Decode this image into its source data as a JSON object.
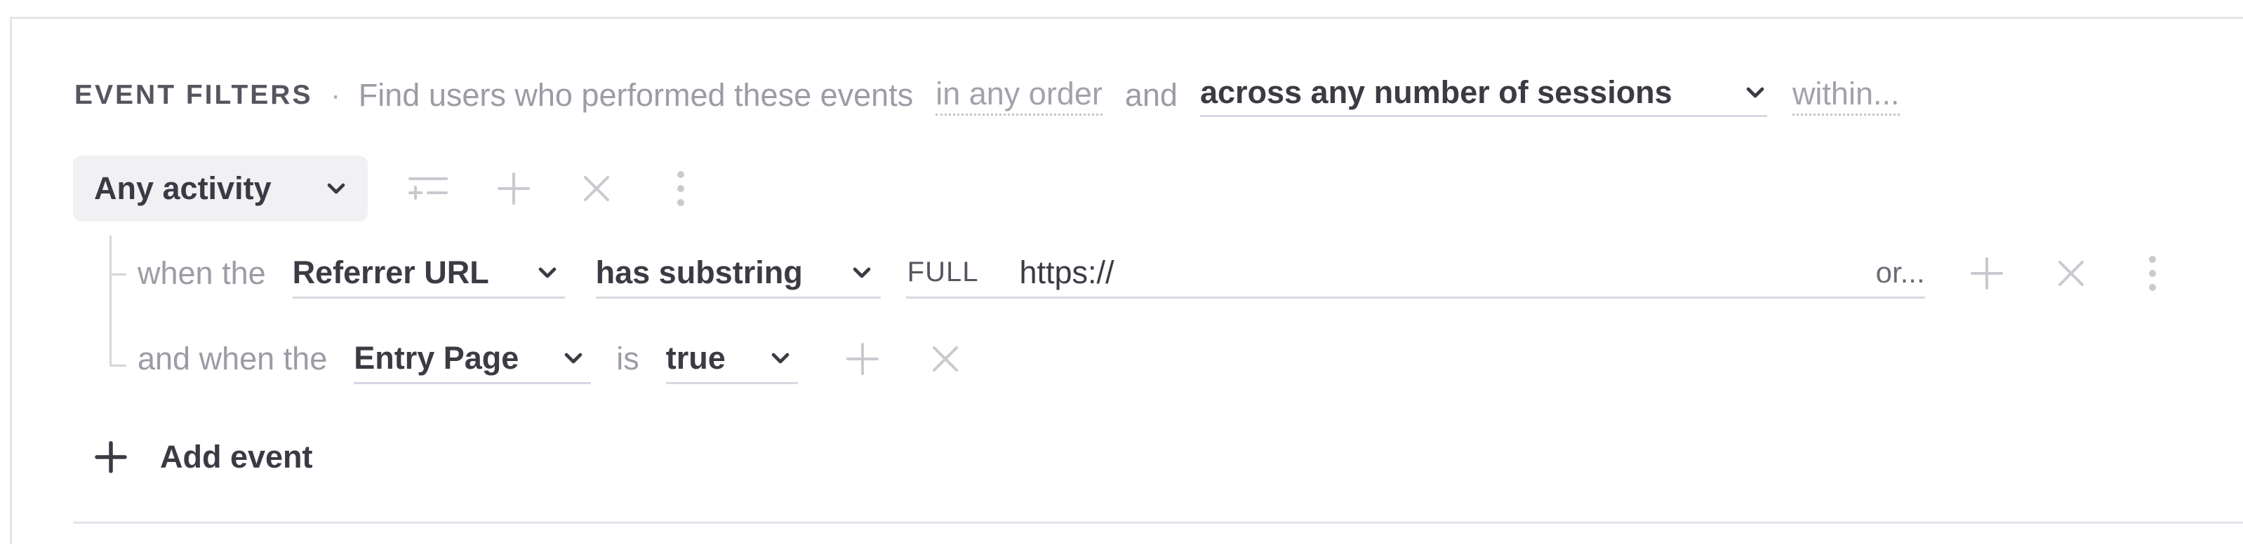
{
  "header": {
    "section_label": "EVENT FILTERS",
    "separator": "·",
    "description": "Find users who performed these events",
    "order_chip": "in any order",
    "and_text": "and",
    "sessions_select": "across any number of sessions",
    "within_chip": "within..."
  },
  "event": {
    "activity_select": "Any activity"
  },
  "filters": [
    {
      "prefix": "when the",
      "property": "Referrer URL",
      "operator": "has substring",
      "match_mode": "FULL",
      "value": "https://",
      "or_link": "or..."
    },
    {
      "prefix": "and when the",
      "property": "Entry Page",
      "connector": "is",
      "value": "true"
    }
  ],
  "add_event_label": "Add event",
  "colors": {
    "icon_muted": "#c9c9cf",
    "text_muted": "#9c9ca6",
    "text_strong": "#3b3b44",
    "pill_bg": "#f1f1f3",
    "underline": "#d8d8e0"
  }
}
